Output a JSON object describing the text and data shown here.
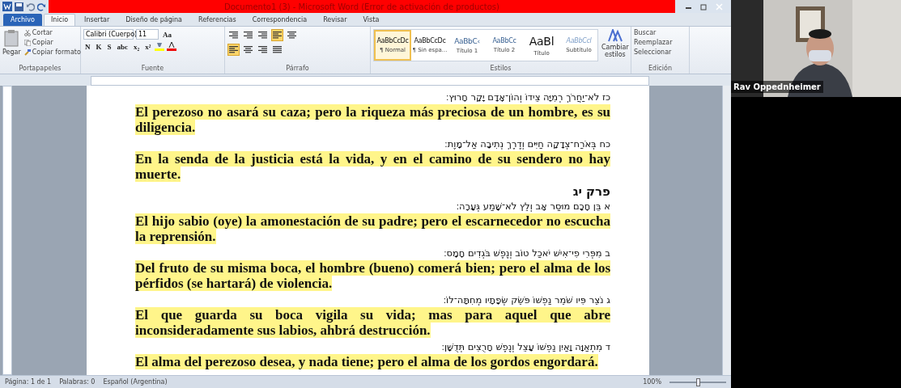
{
  "window": {
    "title": "Documento1 (3) - Microsoft Word (Error de activación de productos)"
  },
  "tabs": [
    {
      "label": "Archivo",
      "kind": "file",
      "selected": false
    },
    {
      "label": "Inicio",
      "kind": "tab",
      "selected": true
    },
    {
      "label": "Insertar",
      "kind": "tab",
      "selected": false
    },
    {
      "label": "Diseño de página",
      "kind": "tab",
      "selected": false
    },
    {
      "label": "Referencias",
      "kind": "tab",
      "selected": false
    },
    {
      "label": "Correspondencia",
      "kind": "tab",
      "selected": false
    },
    {
      "label": "Revisar",
      "kind": "tab",
      "selected": false
    },
    {
      "label": "Vista",
      "kind": "tab",
      "selected": false
    }
  ],
  "clipboard": {
    "paste": "Pegar",
    "cut": "Cortar",
    "copy": "Copiar",
    "format_painter": "Copiar formato",
    "label": "Portapapeles"
  },
  "font": {
    "name": "Calibri (Cuerpo)",
    "size": "11",
    "case_button": "Aa",
    "format_buttons": [
      "N",
      "K",
      "S",
      "abc",
      "x₂",
      "x²"
    ],
    "label": "Fuente"
  },
  "paragraph": {
    "label": "Párrafo",
    "alignments": [
      {
        "selected": true
      },
      {
        "selected": false
      },
      {
        "selected": false
      },
      {
        "selected": false
      }
    ],
    "ltr_selected": true
  },
  "styles": {
    "label": "Estilos",
    "items": [
      {
        "preview": "AaBbCcDc",
        "name": "¶ Normal",
        "kind": "normal",
        "selected": true
      },
      {
        "preview": "AaBbCcDc",
        "name": "¶ Sin espa...",
        "kind": "normal",
        "selected": false
      },
      {
        "preview": "AaBbC‹",
        "name": "Título 1",
        "kind": "heading1",
        "selected": false
      },
      {
        "preview": "AaBbCc",
        "name": "Título 2",
        "kind": "heading2",
        "selected": false
      },
      {
        "preview": "AaBl",
        "name": "Título",
        "kind": "title",
        "selected": false
      },
      {
        "preview": "AaBbCcl",
        "name": "Subtítulo",
        "kind": "subtitle",
        "selected": false
      }
    ],
    "change_styles": "Cambiar estilos"
  },
  "editing": {
    "label": "Edición",
    "items": [
      "Buscar",
      "Reemplazar",
      "Seleccionar"
    ]
  },
  "document": {
    "blocks": [
      {
        "kind": "hebrew",
        "text": "כז לֹא־יַחֲרֹךְ רְמִיָּה צֵידוֹ וְהוֹן־אָדָם יָקָר חָרוּץ׃"
      },
      {
        "kind": "spanish",
        "text": "El perezoso no asará su caza; pero la riqueza más preciosa de un hombre, es su diligencia."
      },
      {
        "kind": "hebrew",
        "text": "כח בְּאֹרַח־צְדָקָה חַיִּים וְדֶרֶךְ נְתִיבָה אַל־מָוֶת׃"
      },
      {
        "kind": "spanish",
        "text": "En la senda de la justicia está la vida, y en el camino de su sendero no hay muerte."
      },
      {
        "kind": "heading",
        "text": "פרק יג"
      },
      {
        "kind": "hebrew",
        "text": "א בֵּן חָכָם מוּסַר אָב וְלֵץ לֹא־שָׁמַע גְּעָרָה׃"
      },
      {
        "kind": "spanish",
        "text": "El hijo sabio (oye) la amonestación de su padre; pero el escarnecedor no escucha la reprensión."
      },
      {
        "kind": "hebrew",
        "text": "ב מִפְּרִי פִי־אִישׁ יֹאכַל טוֹב וְנֶפֶשׁ בֹּגְדִים חָמָס׃"
      },
      {
        "kind": "spanish",
        "text": "Del fruto de su misma boca, el hombre (bueno) comerá bien; pero el alma de los pérfidos  (se hartará)  de violencia."
      },
      {
        "kind": "hebrew",
        "text": "ג נֹצֵר פִּיו שֹׁמֵר נַפְשׁוֹ פֹּשֵׂק שְׂפָתָיו מְחִתָּה־לוֹ׃"
      },
      {
        "kind": "spanish",
        "text": "El que guarda su boca vigila su vida; mas para aquel que abre inconsideradamente sus labios, ahbrá destrucción."
      },
      {
        "kind": "hebrew",
        "text": "ד מִתְאַוָּה וָאַיִן נַפְשׁוֹ עָצֵל וְנֶפֶשׁ חָרֻצִים תְּדֻשָּׁן׃"
      },
      {
        "kind": "spanish",
        "text": "El alma del perezoso desea, y nada tiene; pero el alma de los gordos engordará."
      }
    ]
  },
  "status_bar": {
    "page": "Página: 1 de 1",
    "words": "Palabras: 0",
    "language": "Español (Argentina)",
    "zoom": "100%",
    "level": 0.5
  },
  "video": {
    "name": "Rav Oppednheimer"
  }
}
